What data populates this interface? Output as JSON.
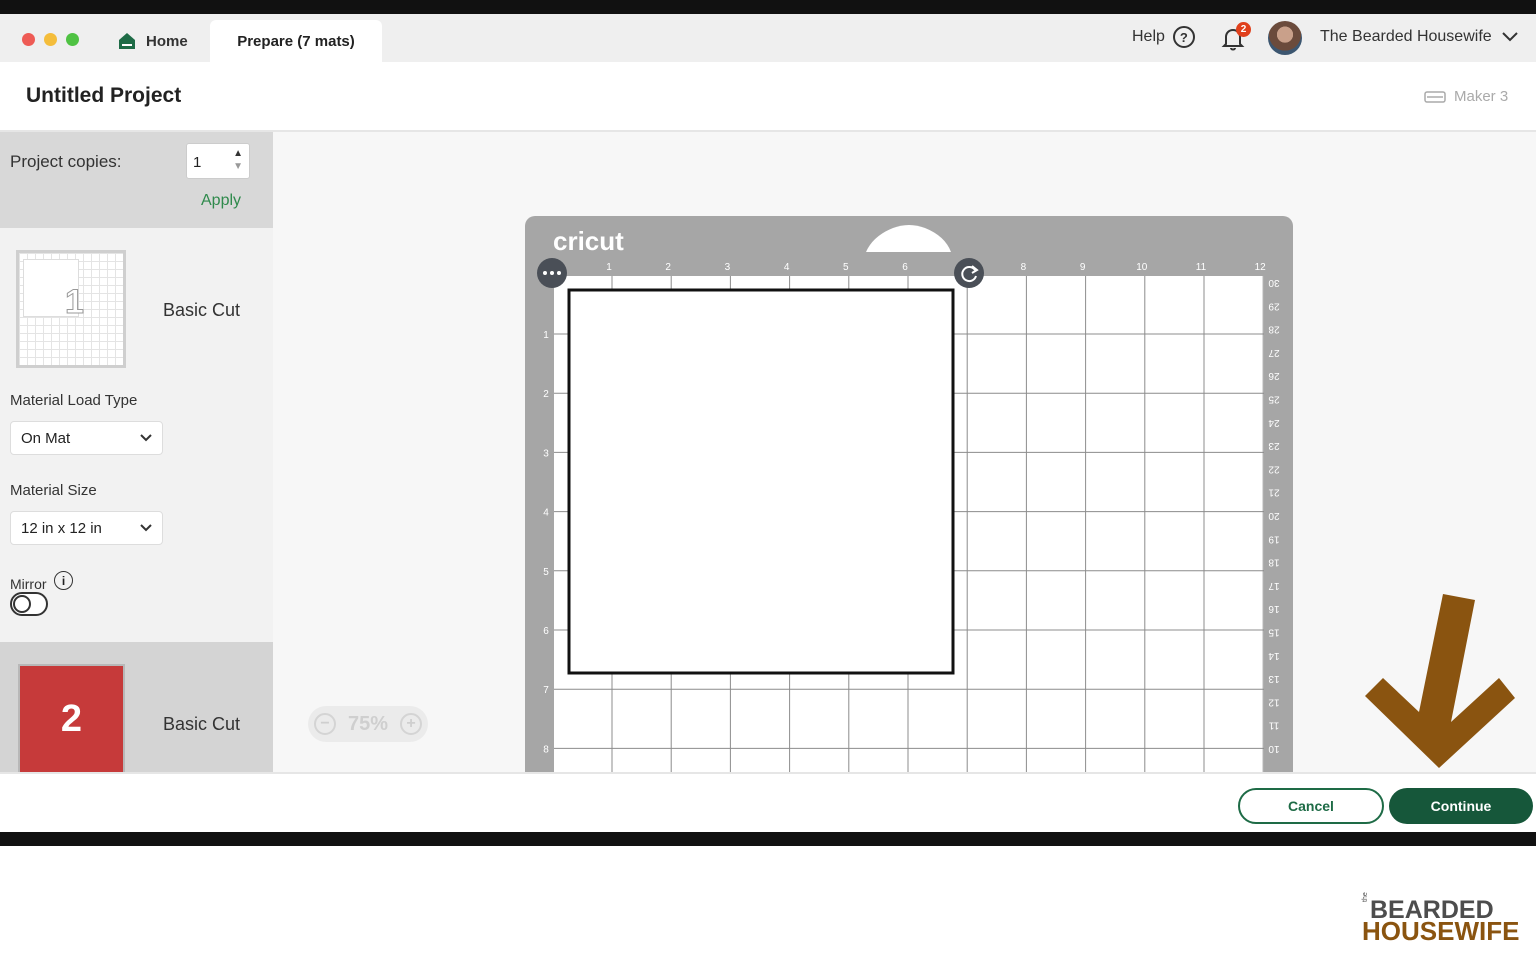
{
  "tabs": {
    "home_label": "Home",
    "prepare_label": "Prepare (7 mats)"
  },
  "topbar": {
    "help_label": "Help",
    "help_icon_glyph": "?",
    "notification_count": "2",
    "user_name": "The Bearded Housewife"
  },
  "header": {
    "title": "Untitled Project",
    "machine": "Maker 3"
  },
  "sidebar": {
    "copies_label": "Project copies:",
    "copies_value": "1",
    "apply_label": "Apply",
    "mat1": {
      "label": "Basic Cut",
      "thumb_number": "1"
    },
    "material_load_type_label": "Material Load Type",
    "material_load_type_value": "On Mat",
    "material_size_label": "Material Size",
    "material_size_value": "12 in x 12 in",
    "mirror_label": "Mirror",
    "mirror_on": false,
    "mat2": {
      "label": "Basic Cut",
      "thumb_number": "2",
      "color": "#c63a3a"
    }
  },
  "mat": {
    "brand": "cricut",
    "top_ruler": [
      "1",
      "2",
      "3",
      "4",
      "5",
      "6",
      "7",
      "8",
      "9",
      "10",
      "11",
      "12"
    ],
    "left_ruler": [
      "1",
      "2",
      "3",
      "4",
      "5",
      "6",
      "7",
      "8"
    ],
    "right_ruler": [
      "30",
      "29",
      "28",
      "27",
      "26",
      "25",
      "24",
      "23",
      "22",
      "21",
      "20",
      "19",
      "18",
      "17",
      "16",
      "15",
      "14",
      "13",
      "12",
      "11",
      "10"
    ],
    "more_icon": "more-options-icon",
    "rotate_icon": "rotate-icon"
  },
  "zoom": {
    "value": "75%"
  },
  "footer": {
    "cancel_label": "Cancel",
    "continue_label": "Continue"
  },
  "logo": {
    "the": "the",
    "line1": "BEARDED",
    "line2": "HOUSEWIFE"
  },
  "colors": {
    "accent_green": "#16573a",
    "mat_gray": "#a6a6a6",
    "annotation_arrow": "#8a5410",
    "notification_red": "#e0401c"
  }
}
